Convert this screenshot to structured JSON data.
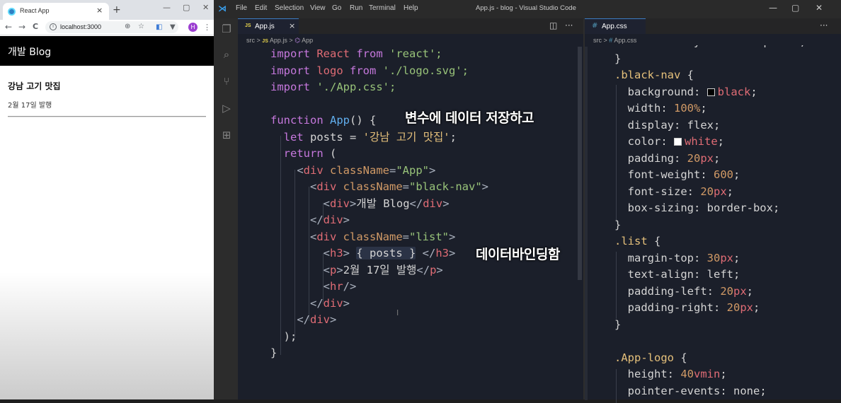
{
  "browser": {
    "tab_title": "React App",
    "tab_close": "×",
    "new_tab": "+",
    "win_min": "—",
    "win_max": "▢",
    "win_close": "✕",
    "back": "←",
    "forward": "→",
    "reload": "C",
    "url": "localhost:3000",
    "avatar_letter": "H",
    "menu": "⋮"
  },
  "page": {
    "nav_title": "개발 Blog",
    "post_title": "강남 고기 맛집",
    "post_date": "2월 17일 발행"
  },
  "vscode": {
    "logo": "⋊",
    "menu": [
      "File",
      "Edit",
      "Selection",
      "View",
      "Go",
      "Run",
      "Terminal",
      "Help"
    ],
    "window_title": "App.js - blog - Visual Studio Code",
    "win_min": "—",
    "win_max": "▢",
    "win_close": "✕",
    "left_tab": {
      "badge": "JS",
      "label": "App.js",
      "close": "×"
    },
    "right_tab": {
      "badge": "#",
      "label": "App.css"
    },
    "left_breadcrumb": {
      "folder": "src",
      "sep": ">",
      "badge": "JS",
      "file": "App.js",
      "symbol": "App"
    },
    "right_breadcrumb": {
      "folder": "src",
      "sep": ">",
      "badge": "#",
      "file": "App.css"
    },
    "split_icon": "◫",
    "more_icon": "···"
  },
  "left_code": {
    "l1": [
      "import",
      " React ",
      "from",
      " 'react';"
    ],
    "l2": [
      "import",
      " logo ",
      "from",
      " './logo.svg';"
    ],
    "l3": [
      "import",
      " './App.css';"
    ],
    "l5": [
      "function",
      " App",
      "() {"
    ],
    "l6": [
      "let",
      " posts = ",
      "'강남 고기 맛집'",
      ";"
    ],
    "l7": [
      "return",
      " ("
    ],
    "l8": [
      "<",
      "div",
      " className",
      "=",
      "\"App\"",
      ">"
    ],
    "l9": [
      "<",
      "div",
      " className",
      "=",
      "\"black-nav\"",
      ">"
    ],
    "l10": [
      "<",
      "div",
      ">",
      "개발 Blog",
      "</",
      "div",
      ">"
    ],
    "l11": [
      "</",
      "div",
      ">"
    ],
    "l12": [
      "<",
      "div",
      " className",
      "=",
      "\"list\"",
      ">"
    ],
    "l13": [
      "<",
      "h3",
      "> ",
      "{ posts }",
      " </",
      "h3",
      ">"
    ],
    "l14": [
      "<",
      "p",
      ">",
      "2월 17일 발행",
      "</",
      "p",
      ">"
    ],
    "l15": [
      "<",
      "hr",
      "/>"
    ],
    "l16": [
      "</",
      "div",
      ">"
    ],
    "l17": [
      "</",
      "div",
      ">"
    ],
    "l18": [
      ");"
    ],
    "l19": [
      "}"
    ]
  },
  "right_code": {
    "r0": "font-family: 'NanumSquare';",
    "r1": "}",
    "r2": [
      ".black-nav",
      " {"
    ],
    "r3": [
      "background: ",
      "black",
      ";"
    ],
    "r4": [
      "width: ",
      "100%",
      ";"
    ],
    "r5": [
      "display: ",
      "flex",
      ";"
    ],
    "r6": [
      "color: ",
      "white",
      ";"
    ],
    "r7": [
      "padding: ",
      "20",
      "px",
      ";"
    ],
    "r8": [
      "font-weight: ",
      "600",
      ";"
    ],
    "r9": [
      "font-size: ",
      "20",
      "px",
      ";"
    ],
    "r10": [
      "box-sizing: ",
      "border-box",
      ";"
    ],
    "r11": "}",
    "r12": [
      ".list",
      " {"
    ],
    "r13": [
      "margin-top: ",
      "30",
      "px",
      ";"
    ],
    "r14": [
      "text-align: ",
      "left",
      ";"
    ],
    "r15": [
      "padding-left: ",
      "20",
      "px",
      ";"
    ],
    "r16": [
      "padding-right: ",
      "20",
      "px",
      ";"
    ],
    "r17": "}",
    "r19": [
      ".App-logo",
      " {"
    ],
    "r20": [
      "height: ",
      "40",
      "vmin",
      ";"
    ],
    "r21": [
      "pointer-events: ",
      "none",
      ";"
    ]
  },
  "overlays": {
    "save_data": "변수에 데이터 저장하고",
    "data_binding": "데이터바인딩함"
  },
  "colors": {
    "swatch_black": "#000000",
    "swatch_white": "#ffffff"
  }
}
